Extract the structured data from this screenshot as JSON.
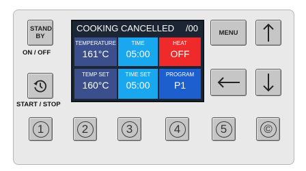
{
  "controls": {
    "standby_label": "STAND BY",
    "onoff_label": "ON / OFF",
    "startstop_label": "START / STOP",
    "menu_label": "MENU"
  },
  "screen": {
    "title": "COOKING CANCELLED",
    "counter": "/00",
    "temperature": {
      "label": "TEMPERATURE",
      "value": "161°C"
    },
    "time": {
      "label": "TIME",
      "value": "05:00"
    },
    "heat": {
      "label": "HEAT",
      "value": "OFF"
    },
    "temp_set": {
      "label": "TEMP SET",
      "value": "160°C"
    },
    "time_set": {
      "label": "TIME SET",
      "value": "05:00"
    },
    "program": {
      "label": "PROGRAM",
      "value": "P1"
    }
  },
  "numbers": [
    "1",
    "2",
    "3",
    "4",
    "5",
    "©"
  ],
  "colors": {
    "navy": "#3b4f8c",
    "cyan": "#19a7f0",
    "red": "#f02a2a",
    "blue": "#1e5fd0"
  },
  "icons": [
    "restart-icon",
    "arrow-up-icon",
    "arrow-down-icon",
    "arrow-left-icon"
  ]
}
